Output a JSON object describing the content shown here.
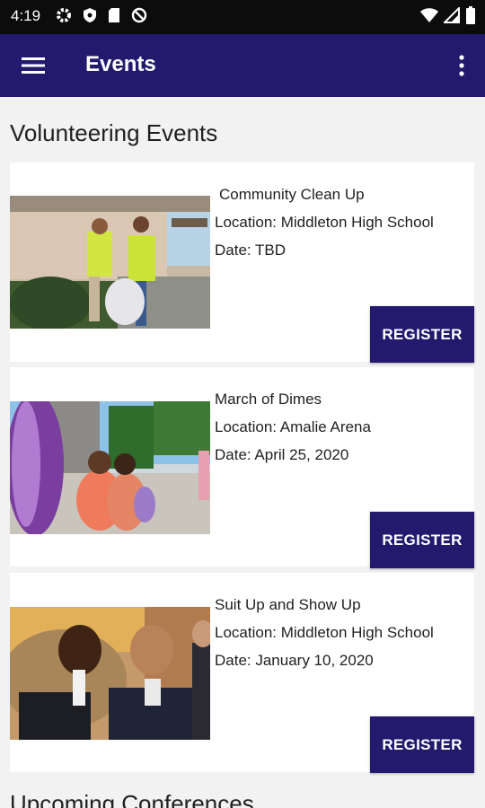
{
  "status_bar": {
    "time": "4:19",
    "left_icons": [
      "gear-icon",
      "shield-icon",
      "sd-card-icon",
      "no-sign-icon"
    ],
    "right_icons": [
      "wifi-icon",
      "signal-icon",
      "battery-icon"
    ]
  },
  "app_bar": {
    "title": "Events",
    "menu_icon": "hamburger-menu-icon",
    "overflow_icon": "more-vert-icon",
    "color": "#231a6e"
  },
  "volunteering": {
    "heading": "Volunteering Events",
    "events": [
      {
        "title": "Community Clean Up",
        "location": "Location: Middleton High School",
        "date": "Date: TBD",
        "button": "REGISTER"
      },
      {
        "title": "March of Dimes",
        "location": "Location: Amalie Arena",
        "date": "Date: April 25, 2020",
        "button": "REGISTER"
      },
      {
        "title": "Suit Up and Show Up",
        "location": "Location: Middleton High School",
        "date": "Date: January 10, 2020",
        "button": "REGISTER"
      }
    ]
  },
  "next_section": {
    "heading": "Upcoming Conferences"
  }
}
